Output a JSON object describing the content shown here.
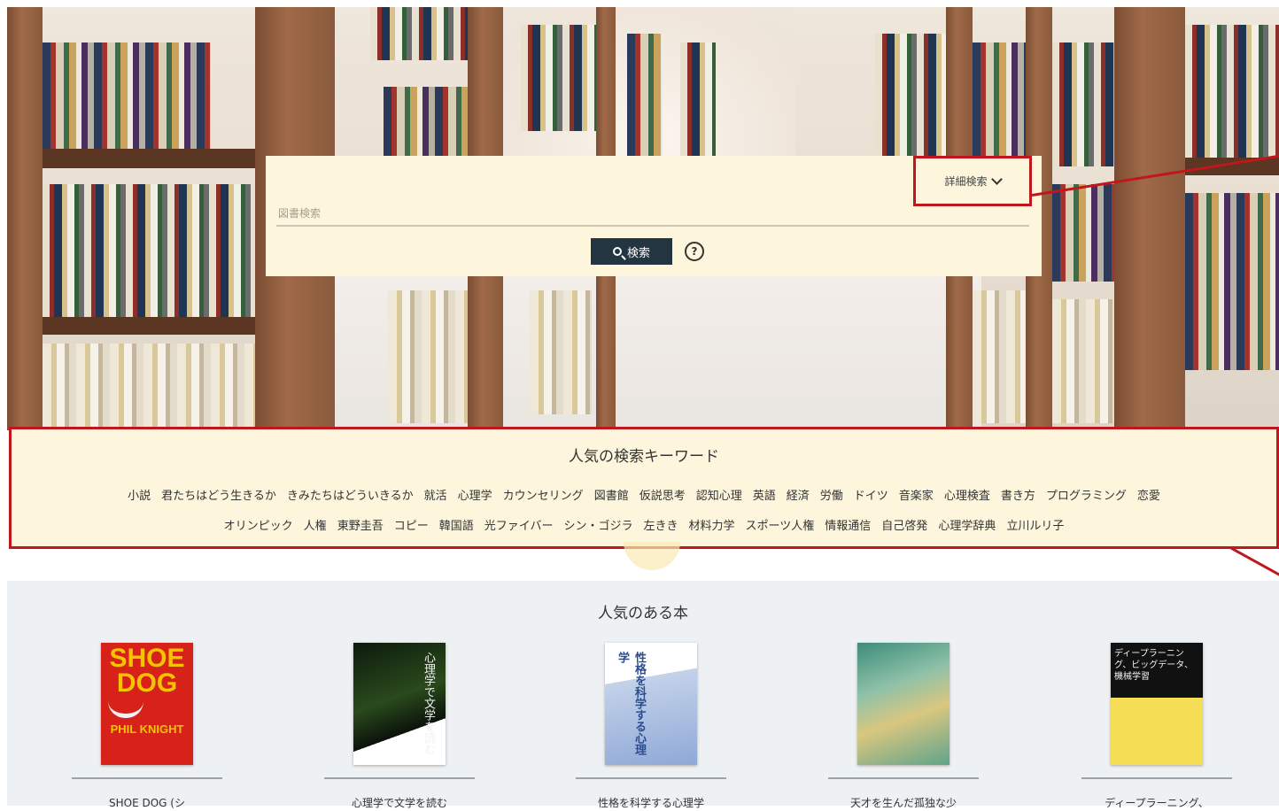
{
  "search": {
    "advanced_label": "詳細検索",
    "placeholder": "図書検索",
    "button_label": "検索",
    "help_label": "?"
  },
  "keywords": {
    "title": "人気の検索キーワード",
    "row1": [
      "小説",
      "君たちはどう生きるか",
      "きみたちはどういきるか",
      "就活",
      "心理学",
      "カウンセリング",
      "図書館",
      "仮説思考",
      "認知心理",
      "英語",
      "経済",
      "労働",
      "ドイツ",
      "音楽家",
      "心理検査",
      "書き方",
      "プログラミング",
      "恋愛"
    ],
    "row2": [
      "オリンピック",
      "人権",
      "東野圭吾",
      "コピー",
      "韓国語",
      "光ファイバー",
      "シン・ゴジラ",
      "左きき",
      "材料力学",
      "スポーツ人権",
      "情報通信",
      "自己啓発",
      "心理学辞典",
      "立川ルリ子"
    ]
  },
  "popular_books": {
    "title": "人気のある本",
    "books": [
      {
        "title": "SHOE DOG (シ",
        "cover_text": "SHOE DOG",
        "cover_sub": "PHIL KNIGHT"
      },
      {
        "title": "心理学で文学を読む",
        "cover_text": "心理学で文学を読む"
      },
      {
        "title": "性格を科学する心理学",
        "cover_text": "性格を科学する心理学"
      },
      {
        "title": "天才を生んだ孤独な少",
        "cover_text": ""
      },
      {
        "title": "ディープラーニング、",
        "cover_text": "ディープラーニング、ビッグデータ、機械学習"
      }
    ]
  },
  "colors": {
    "accent_red": "#c0161c",
    "panel_cream": "#fdf5dc",
    "search_button": "#243542"
  }
}
